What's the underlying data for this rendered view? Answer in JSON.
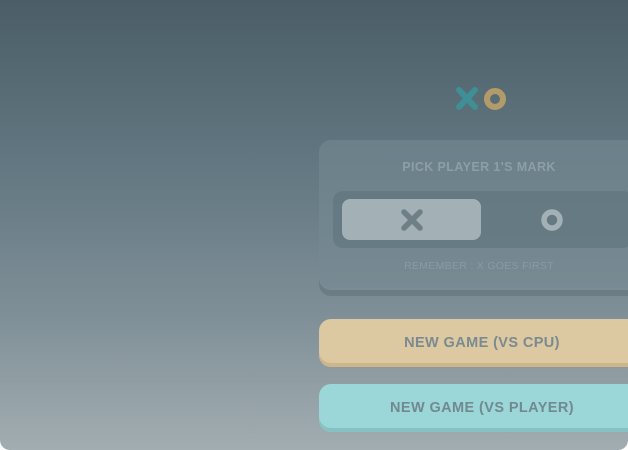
{
  "logo": {
    "icons": [
      "x-icon",
      "o-icon"
    ],
    "x_color": "#3f8f96",
    "o_color": "#b39a6a"
  },
  "mark_picker": {
    "title": "PICK PLAYER 1'S MARK",
    "options": [
      {
        "mark": "x-icon",
        "selected": true
      },
      {
        "mark": "o-icon",
        "selected": false
      }
    ],
    "hint": "REMEMBER : X GOES FIRST"
  },
  "buttons": {
    "vs_cpu": "NEW GAME (VS CPU)",
    "vs_player": "NEW GAME (VS PLAYER)"
  },
  "colors": {
    "cpu_button": "#dcc9a2",
    "player_button": "#9bd6d8"
  }
}
